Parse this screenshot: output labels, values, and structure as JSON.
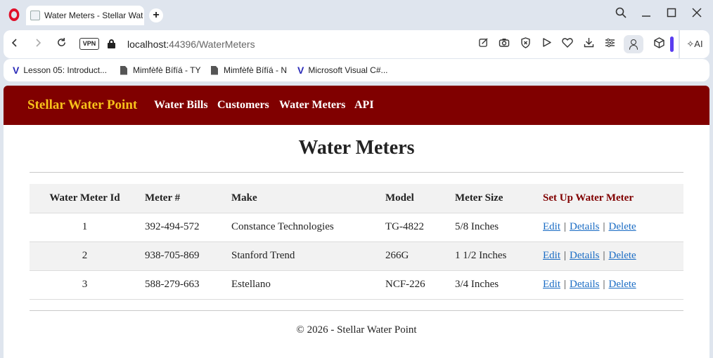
{
  "browser": {
    "tab_title": "Water Meters - Stellar Wat",
    "new_tab_label": "+",
    "url_host": "localhost:",
    "url_path": "44396/WaterMeters",
    "vpn_label": "VPN",
    "ai_label": "AI",
    "bookmarks": [
      {
        "label": "Lesson 05: Introduct...",
        "icon": "vs-icon"
      },
      {
        "label": "Mimfèfè Bífíá - TY",
        "icon": "doc-icon"
      },
      {
        "label": "Mimfèfè Bífíá - N",
        "icon": "doc-icon"
      },
      {
        "label": "Microsoft Visual C#...",
        "icon": "vs-icon"
      }
    ]
  },
  "site": {
    "brand": "Stellar Water Point",
    "nav": [
      "Water Bills",
      "Customers",
      "Water Meters",
      "API"
    ],
    "heading": "Water Meters",
    "footer": "© 2026 - Stellar Water Point"
  },
  "table": {
    "headers": [
      "Water Meter Id",
      "Meter #",
      "Make",
      "Model",
      "Meter Size",
      "Set Up Water Meter"
    ],
    "rows": [
      {
        "id": "1",
        "meter": "392-494-572",
        "make": "Constance Technologies",
        "model": "TG-4822",
        "size": "5/8 Inches"
      },
      {
        "id": "2",
        "meter": "938-705-869",
        "make": "Stanford Trend",
        "model": "266G",
        "size": "1 1/2 Inches"
      },
      {
        "id": "3",
        "meter": "588-279-663",
        "make": "Estellano",
        "model": "NCF-226",
        "size": "3/4 Inches"
      }
    ],
    "actions": {
      "edit": "Edit",
      "details": "Details",
      "delete": "Delete",
      "separator": "|"
    }
  },
  "colors": {
    "navbar": "#800000",
    "brand": "#f7c21a",
    "link": "#1a6cc4",
    "opera_red": "#e0102a"
  }
}
